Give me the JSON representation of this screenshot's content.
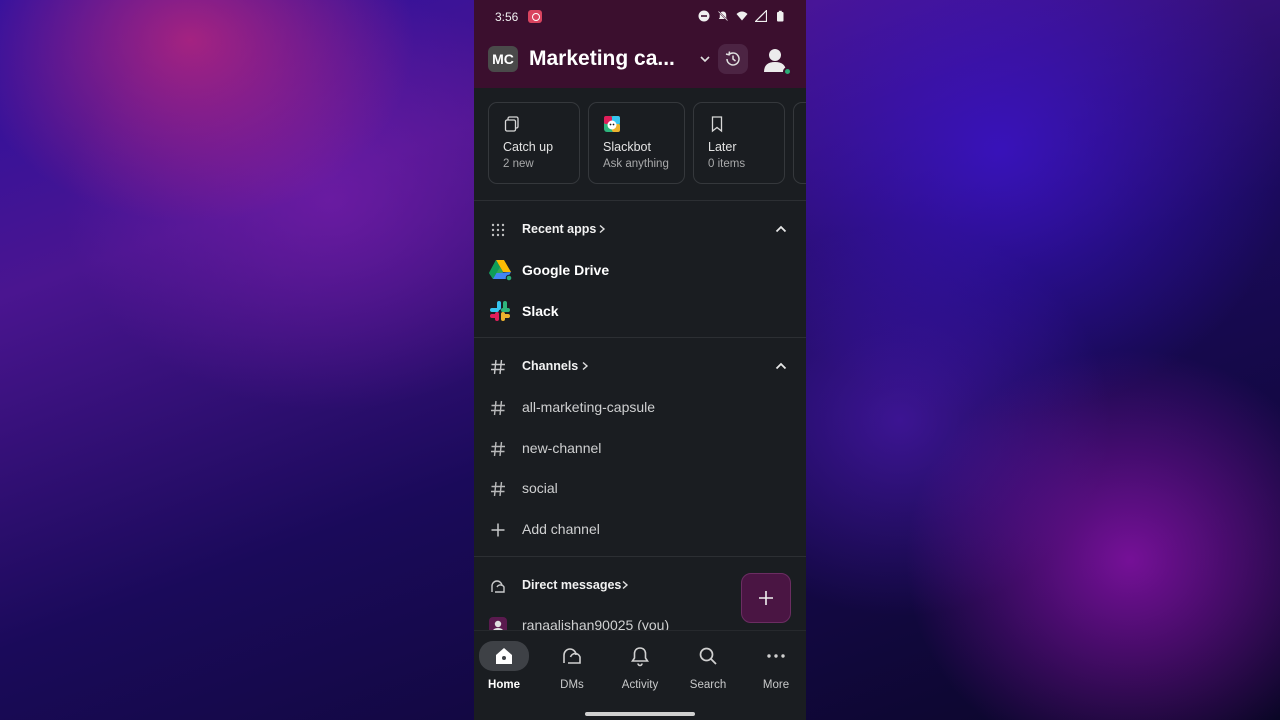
{
  "status_bar": {
    "time": "3:56"
  },
  "workspace": {
    "initials": "MC",
    "name": "Marketing ca..."
  },
  "quick_cards": [
    {
      "icon": "copy-icon",
      "title": "Catch up",
      "subtitle": "2 new"
    },
    {
      "icon": "slackbot-icon",
      "title": "Slackbot",
      "subtitle": "Ask anything"
    },
    {
      "icon": "bookmark-icon",
      "title": "Later",
      "subtitle": "0 items"
    }
  ],
  "recent_apps": {
    "label": "Recent apps",
    "items": [
      {
        "icon": "google-drive-icon",
        "label": "Google Drive"
      },
      {
        "icon": "slack-icon",
        "label": "Slack"
      }
    ]
  },
  "channels": {
    "label": "Channels",
    "items": [
      {
        "label": "all-marketing-capsule"
      },
      {
        "label": "new-channel"
      },
      {
        "label": "social"
      }
    ],
    "add_label": "Add channel"
  },
  "direct_messages": {
    "label": "Direct messages",
    "items": [
      {
        "label": "ranaalishan90025 (you)"
      }
    ]
  },
  "tabs": [
    {
      "icon": "home-icon",
      "label": "Home",
      "active": true
    },
    {
      "icon": "dms-icon",
      "label": "DMs"
    },
    {
      "icon": "bell-icon",
      "label": "Activity"
    },
    {
      "icon": "search-icon",
      "label": "Search"
    },
    {
      "icon": "more-icon",
      "label": "More"
    }
  ],
  "colors": {
    "header_bg": "#3b0f2e",
    "body_bg": "#1a1d21",
    "presence_green": "#2bac76",
    "fab_bg": "#4a1543"
  }
}
